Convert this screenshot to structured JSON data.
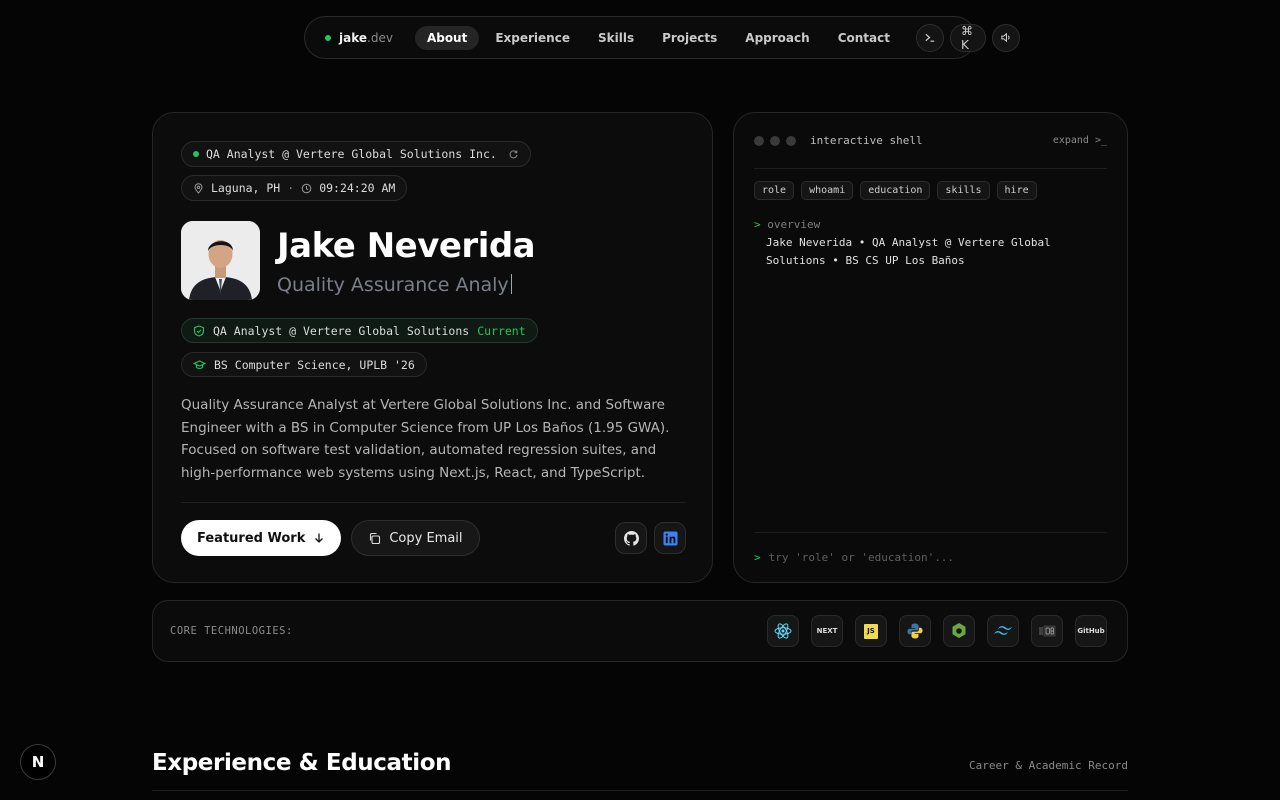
{
  "nav": {
    "brand_main": "jake",
    "brand_ext": ".dev",
    "links": [
      "About",
      "Experience",
      "Skills",
      "Projects",
      "Approach",
      "Contact"
    ],
    "terminal_icon": "terminal-icon",
    "cmd_label": "⌘ K",
    "sound_icon": "speaker-icon"
  },
  "hero": {
    "status": "QA Analyst @ Vertere Global Solutions Inc.",
    "location": "Laguna, PH",
    "separator": "·",
    "time": "09:24:20 AM",
    "name": "Jake Neverida",
    "typing_role": "Quality Assurance Analy",
    "credential_job": "QA Analyst @ Vertere Global Solutions",
    "credential_job_badge": "Current",
    "credential_edu": "BS Computer Science, UPLB '26",
    "bio": "Quality Assurance Analyst at Vertere Global Solutions Inc. and Software Engineer with a BS in Computer Science from UP Los Baños (1.95 GWA). Focused on software test validation, automated regression suites, and high-performance web systems using Next.js, React, and TypeScript.",
    "primary_button": "Featured Work",
    "secondary_button": "Copy Email"
  },
  "shell": {
    "title": "interactive shell",
    "expand": "expand >_",
    "chips": [
      "role",
      "whoami",
      "education",
      "skills",
      "hire"
    ],
    "prompt_symbol": ">",
    "command": "overview",
    "response": "Jake Neverida • QA Analyst @ Vertere Global Solutions • BS CS UP Los Baños",
    "input_placeholder": "try 'role' or 'education'..."
  },
  "tech": {
    "label": "CORE TECHNOLOGIES:",
    "icons": [
      "react-icon",
      "nextjs-icon",
      "javascript-icon",
      "python-icon",
      "nodejs-icon",
      "tailwind-icon",
      "database-icon",
      "github-icon"
    ],
    "next_text": "NEXT",
    "js_text": "JS",
    "github_text": "GitHub"
  },
  "section": {
    "title": "Experience & Education",
    "subtitle": "Career & Academic Record"
  },
  "fab_label": "N",
  "colors": {
    "accent": "#22c55e",
    "background": "#050505",
    "card": "#0c0c0c"
  }
}
